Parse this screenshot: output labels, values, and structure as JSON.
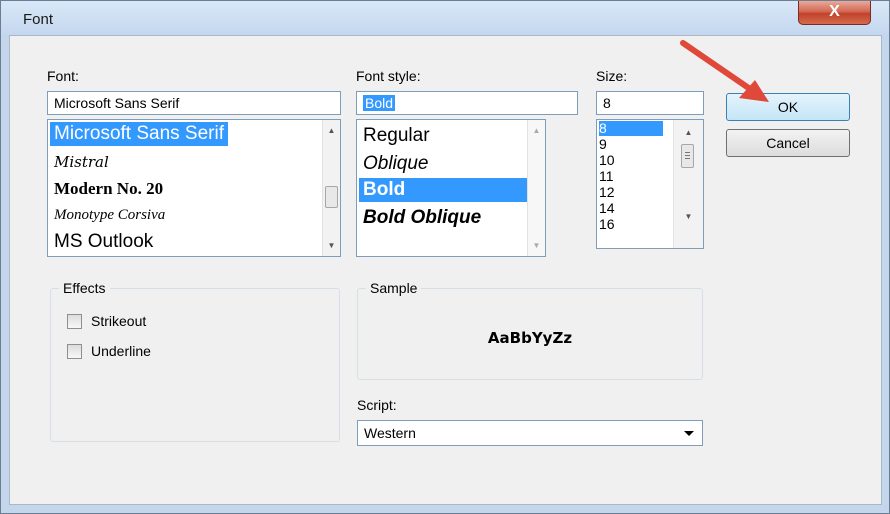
{
  "window": {
    "title": "Font",
    "close_glyph": "X"
  },
  "font": {
    "label": "Font:",
    "value": "Microsoft Sans Serif",
    "items": [
      {
        "label": "Microsoft Sans Serif",
        "selected": true
      },
      {
        "label": "Mistral",
        "selected": false
      },
      {
        "label": "Modern No. 20",
        "selected": false
      },
      {
        "label": "Monotype Corsiva",
        "selected": false
      },
      {
        "label": "MS Outlook",
        "selected": false
      }
    ]
  },
  "style": {
    "label": "Font style:",
    "value": "Bold",
    "items": [
      {
        "label": "Regular",
        "selected": false
      },
      {
        "label": "Oblique",
        "selected": false
      },
      {
        "label": "Bold",
        "selected": true
      },
      {
        "label": "Bold Oblique",
        "selected": false
      }
    ]
  },
  "size": {
    "label": "Size:",
    "value": "8",
    "items": [
      "8",
      "9",
      "10",
      "11",
      "12",
      "14",
      "16"
    ]
  },
  "buttons": {
    "ok": "OK",
    "cancel": "Cancel"
  },
  "effects": {
    "legend": "Effects",
    "strikeout": "Strikeout",
    "underline": "Underline"
  },
  "sample": {
    "legend": "Sample",
    "text": "AaBbYyZz"
  },
  "script": {
    "label": "Script:",
    "value": "Western"
  },
  "colors": {
    "selection": "#3399ff",
    "pointer_arrow": "#e0483a",
    "close_button": "#c9523d"
  },
  "icons": [
    "close-icon",
    "scroll-up-arrow-icon",
    "scroll-down-arrow-icon",
    "dropdown-arrow-icon",
    "red-pointer-arrow-icon"
  ]
}
